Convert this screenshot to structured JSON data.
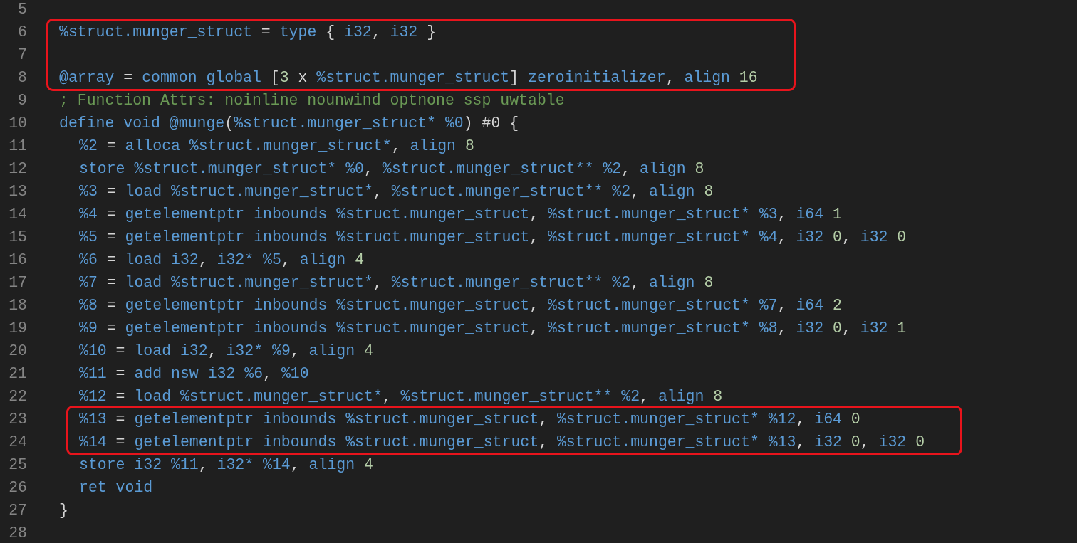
{
  "editor": {
    "blocks": [
      {
        "boxed": false,
        "lines": [
          {
            "number": "5"
          }
        ]
      },
      {
        "boxed": true,
        "lines": [
          {
            "number": "6",
            "tokens": [
              {
                "text": "%struct.munger_struct",
                "kind": "name"
              },
              {
                "text": " = ",
                "kind": "plain"
              },
              {
                "text": "type",
                "kind": "name"
              },
              {
                "text": " { ",
                "kind": "plain"
              },
              {
                "text": "i32",
                "kind": "name"
              },
              {
                "text": ", ",
                "kind": "plain"
              },
              {
                "text": "i32",
                "kind": "name"
              },
              {
                "text": " }",
                "kind": "plain"
              }
            ]
          },
          {
            "number": "7"
          },
          {
            "number": "8",
            "tokens": [
              {
                "text": "@array",
                "kind": "name"
              },
              {
                "text": " = ",
                "kind": "plain"
              },
              {
                "text": "common global",
                "kind": "name"
              },
              {
                "text": " [",
                "kind": "plain"
              },
              {
                "text": "3",
                "kind": "number"
              },
              {
                "text": " x ",
                "kind": "plain"
              },
              {
                "text": "%struct.munger_struct",
                "kind": "name"
              },
              {
                "text": "] ",
                "kind": "plain"
              },
              {
                "text": "zeroinitializer",
                "kind": "name"
              },
              {
                "text": ", ",
                "kind": "plain"
              },
              {
                "text": "align ",
                "kind": "name"
              },
              {
                "text": "16",
                "kind": "number"
              }
            ]
          }
        ]
      },
      {
        "boxed": false,
        "lines": [
          {
            "number": "9",
            "tokens": [
              {
                "text": "; Function Attrs: noinline nounwind optnone ssp uwtable",
                "kind": "comment"
              }
            ]
          },
          {
            "number": "10",
            "tokens": [
              {
                "text": "define void @munge",
                "kind": "name"
              },
              {
                "text": "(",
                "kind": "plain"
              },
              {
                "text": "%struct.munger_struct* %0",
                "kind": "name"
              },
              {
                "text": ") #0 {",
                "kind": "plain"
              }
            ],
            "children": [
              {
                "boxed": false,
                "lines": [
                  {
                    "number": "11",
                    "tokens": [
                      {
                        "text": "%2",
                        "kind": "name"
                      },
                      {
                        "text": " = ",
                        "kind": "plain"
                      },
                      {
                        "text": "alloca %struct.munger_struct*",
                        "kind": "name"
                      },
                      {
                        "text": ", ",
                        "kind": "plain"
                      },
                      {
                        "text": "align ",
                        "kind": "name"
                      },
                      {
                        "text": "8",
                        "kind": "number"
                      }
                    ]
                  },
                  {
                    "number": "12",
                    "tokens": [
                      {
                        "text": "store %struct.munger_struct* %0",
                        "kind": "name"
                      },
                      {
                        "text": ", ",
                        "kind": "plain"
                      },
                      {
                        "text": "%struct.munger_struct** %2",
                        "kind": "name"
                      },
                      {
                        "text": ", ",
                        "kind": "plain"
                      },
                      {
                        "text": "align ",
                        "kind": "name"
                      },
                      {
                        "text": "8",
                        "kind": "number"
                      }
                    ]
                  },
                  {
                    "number": "13",
                    "tokens": [
                      {
                        "text": "%3",
                        "kind": "name"
                      },
                      {
                        "text": " = ",
                        "kind": "plain"
                      },
                      {
                        "text": "load %struct.munger_struct*",
                        "kind": "name"
                      },
                      {
                        "text": ", ",
                        "kind": "plain"
                      },
                      {
                        "text": "%struct.munger_struct** %2",
                        "kind": "name"
                      },
                      {
                        "text": ", ",
                        "kind": "plain"
                      },
                      {
                        "text": "align ",
                        "kind": "name"
                      },
                      {
                        "text": "8",
                        "kind": "number"
                      }
                    ]
                  },
                  {
                    "number": "14",
                    "tokens": [
                      {
                        "text": "%4",
                        "kind": "name"
                      },
                      {
                        "text": " = ",
                        "kind": "plain"
                      },
                      {
                        "text": "getelementptr inbounds %struct.munger_struct",
                        "kind": "name"
                      },
                      {
                        "text": ", ",
                        "kind": "plain"
                      },
                      {
                        "text": "%struct.munger_struct* %3",
                        "kind": "name"
                      },
                      {
                        "text": ", ",
                        "kind": "plain"
                      },
                      {
                        "text": "i64 ",
                        "kind": "name"
                      },
                      {
                        "text": "1",
                        "kind": "number"
                      }
                    ]
                  },
                  {
                    "number": "15",
                    "tokens": [
                      {
                        "text": "%5",
                        "kind": "name"
                      },
                      {
                        "text": " = ",
                        "kind": "plain"
                      },
                      {
                        "text": "getelementptr inbounds %struct.munger_struct",
                        "kind": "name"
                      },
                      {
                        "text": ", ",
                        "kind": "plain"
                      },
                      {
                        "text": "%struct.munger_struct* %4",
                        "kind": "name"
                      },
                      {
                        "text": ", ",
                        "kind": "plain"
                      },
                      {
                        "text": "i32 ",
                        "kind": "name"
                      },
                      {
                        "text": "0",
                        "kind": "number"
                      },
                      {
                        "text": ", ",
                        "kind": "plain"
                      },
                      {
                        "text": "i32 ",
                        "kind": "name"
                      },
                      {
                        "text": "0",
                        "kind": "number"
                      }
                    ]
                  },
                  {
                    "number": "16",
                    "tokens": [
                      {
                        "text": "%6",
                        "kind": "name"
                      },
                      {
                        "text": " = ",
                        "kind": "plain"
                      },
                      {
                        "text": "load i32",
                        "kind": "name"
                      },
                      {
                        "text": ", ",
                        "kind": "plain"
                      },
                      {
                        "text": "i32* %5",
                        "kind": "name"
                      },
                      {
                        "text": ", ",
                        "kind": "plain"
                      },
                      {
                        "text": "align ",
                        "kind": "name"
                      },
                      {
                        "text": "4",
                        "kind": "number"
                      }
                    ]
                  },
                  {
                    "number": "17",
                    "tokens": [
                      {
                        "text": "%7",
                        "kind": "name"
                      },
                      {
                        "text": " = ",
                        "kind": "plain"
                      },
                      {
                        "text": "load %struct.munger_struct*",
                        "kind": "name"
                      },
                      {
                        "text": ", ",
                        "kind": "plain"
                      },
                      {
                        "text": "%struct.munger_struct** %2",
                        "kind": "name"
                      },
                      {
                        "text": ", ",
                        "kind": "plain"
                      },
                      {
                        "text": "align ",
                        "kind": "name"
                      },
                      {
                        "text": "8",
                        "kind": "number"
                      }
                    ]
                  },
                  {
                    "number": "18",
                    "tokens": [
                      {
                        "text": "%8",
                        "kind": "name"
                      },
                      {
                        "text": " = ",
                        "kind": "plain"
                      },
                      {
                        "text": "getelementptr inbounds %struct.munger_struct",
                        "kind": "name"
                      },
                      {
                        "text": ", ",
                        "kind": "plain"
                      },
                      {
                        "text": "%struct.munger_struct* %7",
                        "kind": "name"
                      },
                      {
                        "text": ", ",
                        "kind": "plain"
                      },
                      {
                        "text": "i64 ",
                        "kind": "name"
                      },
                      {
                        "text": "2",
                        "kind": "number"
                      }
                    ]
                  },
                  {
                    "number": "19",
                    "tokens": [
                      {
                        "text": "%9",
                        "kind": "name"
                      },
                      {
                        "text": " = ",
                        "kind": "plain"
                      },
                      {
                        "text": "getelementptr inbounds %struct.munger_struct",
                        "kind": "name"
                      },
                      {
                        "text": ", ",
                        "kind": "plain"
                      },
                      {
                        "text": "%struct.munger_struct* %8",
                        "kind": "name"
                      },
                      {
                        "text": ", ",
                        "kind": "plain"
                      },
                      {
                        "text": "i32 ",
                        "kind": "name"
                      },
                      {
                        "text": "0",
                        "kind": "number"
                      },
                      {
                        "text": ", ",
                        "kind": "plain"
                      },
                      {
                        "text": "i32 ",
                        "kind": "name"
                      },
                      {
                        "text": "1",
                        "kind": "number"
                      }
                    ]
                  },
                  {
                    "number": "20",
                    "tokens": [
                      {
                        "text": "%10",
                        "kind": "name"
                      },
                      {
                        "text": " = ",
                        "kind": "plain"
                      },
                      {
                        "text": "load i32",
                        "kind": "name"
                      },
                      {
                        "text": ", ",
                        "kind": "plain"
                      },
                      {
                        "text": "i32* %9",
                        "kind": "name"
                      },
                      {
                        "text": ", ",
                        "kind": "plain"
                      },
                      {
                        "text": "align ",
                        "kind": "name"
                      },
                      {
                        "text": "4",
                        "kind": "number"
                      }
                    ]
                  },
                  {
                    "number": "21",
                    "tokens": [
                      {
                        "text": "%11",
                        "kind": "name"
                      },
                      {
                        "text": " = ",
                        "kind": "plain"
                      },
                      {
                        "text": "add nsw i32 %6",
                        "kind": "name"
                      },
                      {
                        "text": ", ",
                        "kind": "plain"
                      },
                      {
                        "text": "%10",
                        "kind": "name"
                      }
                    ]
                  },
                  {
                    "number": "22",
                    "tokens": [
                      {
                        "text": "%12",
                        "kind": "name"
                      },
                      {
                        "text": " = ",
                        "kind": "plain"
                      },
                      {
                        "text": "load %struct.munger_struct*",
                        "kind": "name"
                      },
                      {
                        "text": ", ",
                        "kind": "plain"
                      },
                      {
                        "text": "%struct.munger_struct** %2",
                        "kind": "name"
                      },
                      {
                        "text": ", ",
                        "kind": "plain"
                      },
                      {
                        "text": "align ",
                        "kind": "name"
                      },
                      {
                        "text": "8",
                        "kind": "number"
                      }
                    ]
                  }
                ]
              },
              {
                "boxed": true,
                "lines": [
                  {
                    "number": "23",
                    "tokens": [
                      {
                        "text": "%13",
                        "kind": "name"
                      },
                      {
                        "text": " = ",
                        "kind": "plain"
                      },
                      {
                        "text": "getelementptr inbounds %struct.munger_struct",
                        "kind": "name"
                      },
                      {
                        "text": ", ",
                        "kind": "plain"
                      },
                      {
                        "text": "%struct.munger_struct* %12",
                        "kind": "name"
                      },
                      {
                        "text": ", ",
                        "kind": "plain"
                      },
                      {
                        "text": "i64 ",
                        "kind": "name"
                      },
                      {
                        "text": "0",
                        "kind": "number"
                      }
                    ]
                  },
                  {
                    "number": "24",
                    "tokens": [
                      {
                        "text": "%14",
                        "kind": "name"
                      },
                      {
                        "text": " = ",
                        "kind": "plain"
                      },
                      {
                        "text": "getelementptr inbounds %struct.munger_struct",
                        "kind": "name"
                      },
                      {
                        "text": ", ",
                        "kind": "plain"
                      },
                      {
                        "text": "%struct.munger_struct* %13",
                        "kind": "name"
                      },
                      {
                        "text": ", ",
                        "kind": "plain"
                      },
                      {
                        "text": "i32 ",
                        "kind": "name"
                      },
                      {
                        "text": "0",
                        "kind": "number"
                      },
                      {
                        "text": ", ",
                        "kind": "plain"
                      },
                      {
                        "text": "i32 ",
                        "kind": "name"
                      },
                      {
                        "text": "0",
                        "kind": "number"
                      }
                    ]
                  }
                ]
              },
              {
                "boxed": false,
                "lines": [
                  {
                    "number": "25",
                    "tokens": [
                      {
                        "text": "store i32 %11",
                        "kind": "name"
                      },
                      {
                        "text": ", ",
                        "kind": "plain"
                      },
                      {
                        "text": "i32* %14",
                        "kind": "name"
                      },
                      {
                        "text": ", ",
                        "kind": "plain"
                      },
                      {
                        "text": "align ",
                        "kind": "name"
                      },
                      {
                        "text": "4",
                        "kind": "number"
                      }
                    ]
                  },
                  {
                    "number": "26",
                    "tokens": [
                      {
                        "text": "ret void",
                        "kind": "name"
                      }
                    ]
                  }
                ]
              }
            ]
          },
          {
            "number": "27",
            "tokens": [
              {
                "text": "}",
                "kind": "plain"
              }
            ]
          },
          {
            "number": "28"
          }
        ]
      }
    ]
  }
}
